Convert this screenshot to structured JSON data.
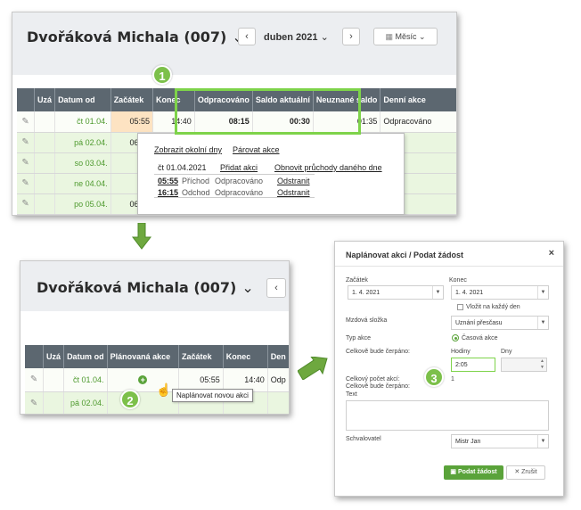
{
  "top": {
    "title": "Dvořáková Michala (007)",
    "month": "duben 2021",
    "view_select": "Měsíc",
    "columns": [
      "",
      "Uzá",
      "Datum od",
      "Začátek",
      "Konec",
      "Odpracováno",
      "Saldo aktuální",
      "Neuznané saldo",
      "Denní akce"
    ],
    "rows": [
      {
        "date": "čt 01.04.",
        "start": "05:55",
        "end": "14:40",
        "worked": "08:15",
        "saldo": "00:30",
        "neuzn": "01:35",
        "action": "Odpracováno"
      },
      {
        "date": "pá 02.04.",
        "start": "06:00",
        "end": "",
        "worked": "",
        "saldo": "",
        "neuzn": "",
        "action": ""
      },
      {
        "date": "so 03.04.",
        "start": "",
        "end": "",
        "worked": "",
        "saldo": "",
        "neuzn": "",
        "action": ""
      },
      {
        "date": "ne 04.04.",
        "start": "",
        "end": "",
        "worked": "",
        "saldo": "",
        "neuzn": "",
        "action": ""
      },
      {
        "date": "po 05.04.",
        "start": "06:00",
        "end": "",
        "worked": "",
        "saldo": "",
        "neuzn": "",
        "action": ""
      }
    ],
    "popup": {
      "link_neighbor_days": "Zobrazit okolní dny",
      "link_pair_actions": "Párovat akce",
      "date": "čt 01.04.2021",
      "link_add_action": "Přidat akci",
      "link_refresh": "Obnovit průchody daného dne",
      "passes": [
        {
          "time": "05:55",
          "type": "Příchod",
          "status": "Odpracováno",
          "remove": "Odstranit"
        },
        {
          "time": "16:15",
          "type": "Odchod",
          "status": "Odpracováno",
          "remove": "Odstranit"
        }
      ]
    }
  },
  "bottom_left": {
    "title": "Dvořáková Michala (007)",
    "columns": [
      "",
      "Uzá",
      "Datum od",
      "Plánovaná akce",
      "Začátek",
      "Konec",
      "Den"
    ],
    "rows": [
      {
        "date": "čt 01.04.",
        "start": "05:55",
        "end": "14:40",
        "den": "Odp"
      },
      {
        "date": "pá 02.04.",
        "start": "",
        "end": "",
        "den": ""
      }
    ],
    "tooltip": "Naplánovat novou akci"
  },
  "dialog": {
    "title": "Naplánovat akci / Podat žádost",
    "start_label": "Začátek",
    "start_value": "1. 4. 2021",
    "end_label": "Konec",
    "end_value": "1. 4. 2021",
    "every_day_label": "Vložit na každý den",
    "wage_label": "Mzdová složka",
    "wage_value": "Uznání přesčasu",
    "action_type_label": "Typ akce",
    "action_type_value": "Časová akce",
    "total_label": "Celkově bude čerpáno:",
    "hours_label": "Hodiny",
    "hours_value": "2:05",
    "days_label": "Dny",
    "count_label": "Celkový počet akcí:",
    "count_value": "1",
    "total_label2": "Celkově bude čerpáno:",
    "text_label": "Text",
    "approver_label": "Schvalovatel",
    "approver_value": "Mistr Jan",
    "submit": "Podat žádost",
    "cancel": "Zrušit"
  },
  "badges": [
    "1",
    "2",
    "3"
  ],
  "colors": {
    "accent_green": "#7ed34a",
    "header_gray": "#5c6770",
    "row_green": "#eaf6e0",
    "date_green": "#4e9a2e",
    "start_highlight": "#fde3c2"
  }
}
